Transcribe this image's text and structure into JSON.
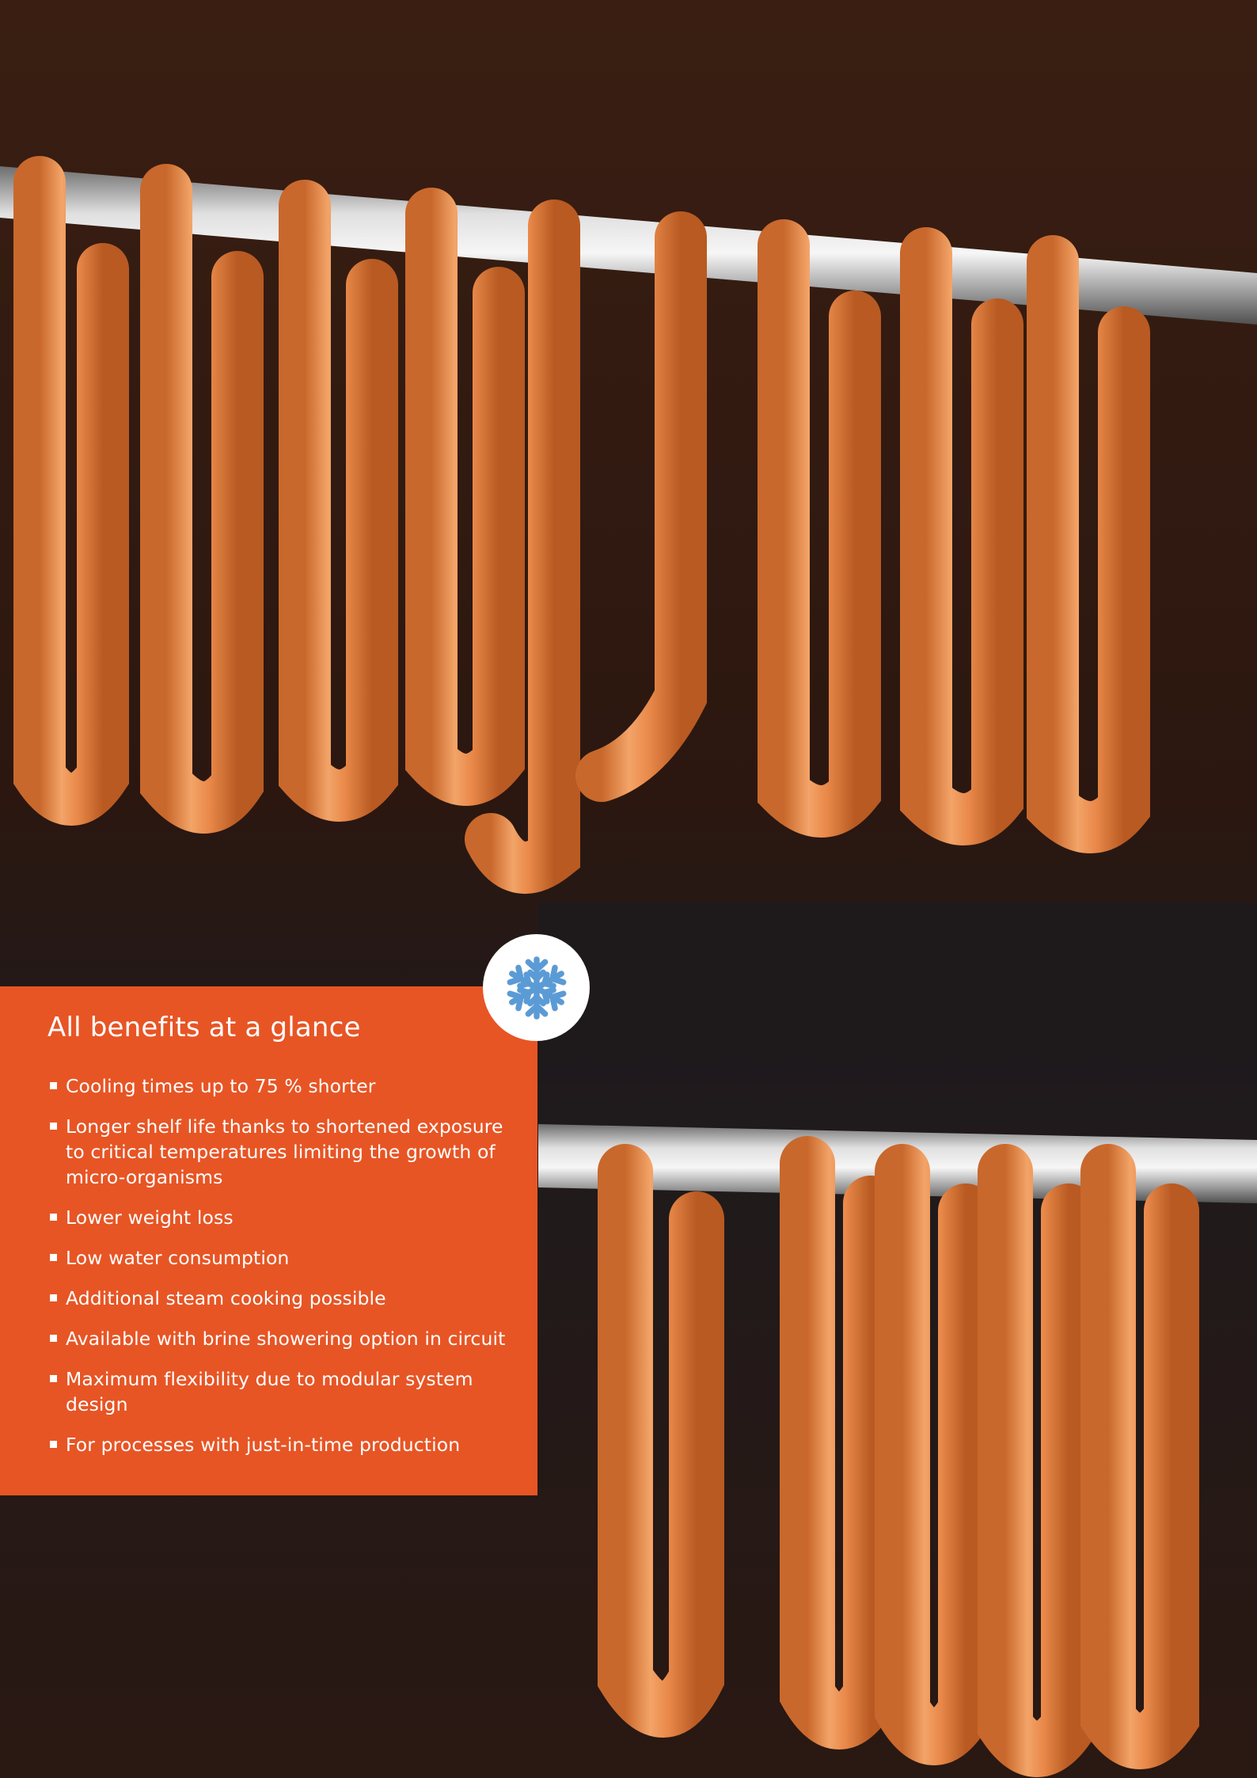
{
  "benefits": {
    "title": "All benefits at a glance",
    "items": [
      "Cooling times up to 75 % shorter",
      "Longer shelf life thanks to shortened exposure to critical temperatures limiting the growth of micro-organisms",
      "Lower weight loss",
      "Low water consumption",
      "Additional steam cooking possible",
      "Available with brine showering option in circuit",
      "Maximum flexibility due to modular system design",
      "For processes with just-in-time production"
    ]
  },
  "badge": {
    "icon": "snowflake-icon",
    "icon_color": "#5b9bd5"
  },
  "colors": {
    "panel_background": "#e75525",
    "panel_text": "#ffffff",
    "badge_background": "#ffffff"
  }
}
